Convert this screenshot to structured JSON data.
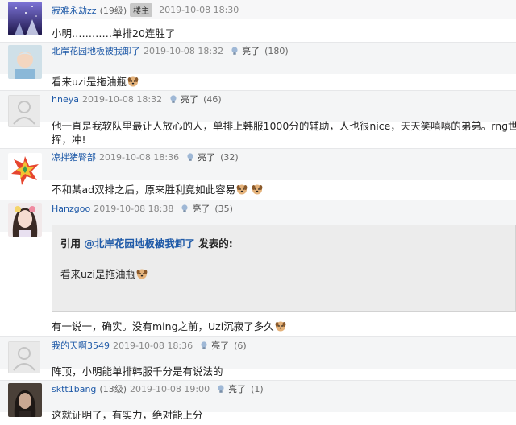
{
  "posts": [
    {
      "username": "寂难永劫zz",
      "level": "(19级)",
      "badge": "楼主",
      "time": "2019-10-08 18:30",
      "content": "小明…………单排20连胜了"
    },
    {
      "username": "北岸花园地板被我卸了",
      "time": "2019-10-08 18:32",
      "light_label": "亮了",
      "light_count": "(180)",
      "content": "看来uzi是拖油瓶"
    },
    {
      "username": "hneya",
      "time": "2019-10-08 18:32",
      "light_label": "亮了",
      "light_count": "(46)",
      "content_line1": "他一直是我软队里最让人放心的人，单排上韩服1000分的辅助，人也很nice，天天笑嘻嘻的弟弟。rng世",
      "content_line2": "挥，冲!"
    },
    {
      "username": "凉拌猪臀部",
      "time": "2019-10-08 18:36",
      "light_label": "亮了",
      "light_count": "(32)",
      "content": "不和某ad双排之后，原来胜利竟如此容易"
    },
    {
      "username": "Hanzgoo",
      "time": "2019-10-08 18:38",
      "light_label": "亮了",
      "light_count": "(35)",
      "quote": {
        "prefix": "引用 ",
        "ref": "@北岸花园地板被我卸了",
        "suffix": " 发表的:",
        "body": "看来uzi是拖油瓶"
      },
      "content": "有一说一，确实。没有ming之前，Uzi沉寂了多久"
    },
    {
      "username": "我的天啊3549",
      "time": "2019-10-08 18:36",
      "light_label": "亮了",
      "light_count": "(6)",
      "content": "阵顶，小明能单排韩服千分是有说法的"
    },
    {
      "username": "sktt1bang",
      "level": "(13级)",
      "time": "2019-10-08 19:00",
      "light_label": "亮了",
      "light_count": "(1)",
      "content": "这就证明了，有实力，绝对能上分"
    }
  ],
  "colors": {
    "username": "#1f5aa8",
    "meta_bg": "#f4f5f6",
    "quote_bg": "#ececec"
  },
  "icons": [
    "lightbulb-icon",
    "dog-emoji-icon",
    "default-avatar-icon"
  ]
}
